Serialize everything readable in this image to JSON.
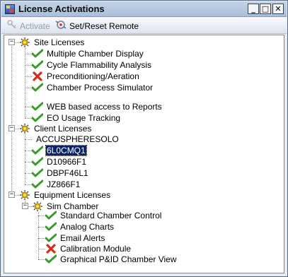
{
  "window": {
    "title": "License Activations"
  },
  "toolbar": {
    "activate_label": "Activate",
    "reset_label": "Set/Reset Remote"
  },
  "controls": {
    "minimize": "_",
    "maximize": "□",
    "close": "✕"
  },
  "tree": {
    "site": {
      "label": "Site Licenses",
      "items": [
        {
          "label": "Multiple Chamber Display",
          "status": "check"
        },
        {
          "label": "Cycle Flammability Analysis",
          "status": "check"
        },
        {
          "label": "Preconditioning/Aeration",
          "status": "cross"
        },
        {
          "label": "Chamber Process Simulator",
          "status": "check"
        },
        {
          "label": "",
          "status": "none"
        },
        {
          "label": "WEB based access to Reports",
          "status": "check"
        },
        {
          "label": "EO Usage Tracking",
          "status": "check"
        }
      ]
    },
    "client": {
      "label": "Client Licenses",
      "items": [
        {
          "label": "ACCUSPHERESOLO",
          "status": "none"
        },
        {
          "label": "6L0CMQ1",
          "status": "check",
          "selected": true
        },
        {
          "label": "D10966F1",
          "status": "check"
        },
        {
          "label": "DBPF46L1",
          "status": "check"
        },
        {
          "label": "JZ866F1",
          "status": "check"
        }
      ]
    },
    "equipment": {
      "label": "Equipment Licenses",
      "sim": {
        "label": "Sim Chamber",
        "items": [
          {
            "label": "Standard Chamber Control",
            "status": "check"
          },
          {
            "label": "Analog Charts",
            "status": "check"
          },
          {
            "label": "Email Alerts",
            "status": "check"
          },
          {
            "label": "Calibration Module",
            "status": "cross"
          },
          {
            "label": "Graphical P&ID Chamber View",
            "status": "check"
          }
        ]
      }
    }
  },
  "colors": {
    "check": "#3c9a2a",
    "cross": "#d62a1a",
    "group_icon": "#e2b10a",
    "selection": "#0a246a"
  }
}
